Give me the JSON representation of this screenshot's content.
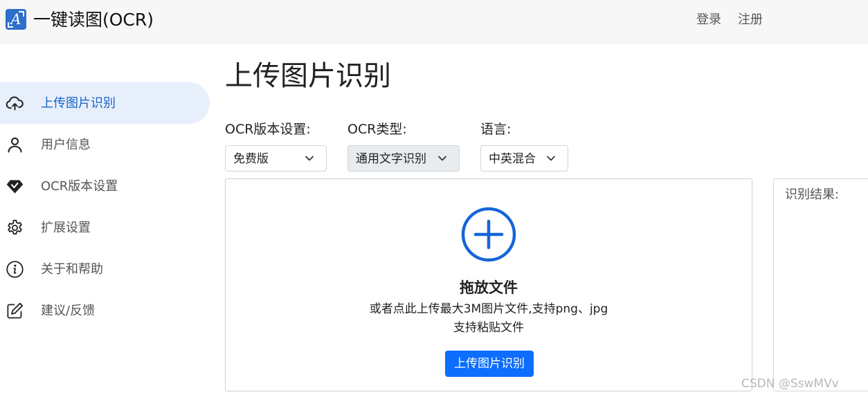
{
  "header": {
    "logo_glyph": "A",
    "app_title": "一键读图(OCR)",
    "login": "登录",
    "register": "注册"
  },
  "sidebar": {
    "items": [
      {
        "label": "上传图片识别",
        "icon": "cloud-upload-icon",
        "active": true
      },
      {
        "label": "用户信息",
        "icon": "user-icon",
        "active": false
      },
      {
        "label": "OCR版本设置",
        "icon": "gem-icon",
        "active": false
      },
      {
        "label": "扩展设置",
        "icon": "gear-icon",
        "active": false
      },
      {
        "label": "关于和帮助",
        "icon": "info-icon",
        "active": false
      },
      {
        "label": "建议/反馈",
        "icon": "edit-icon",
        "active": false
      }
    ]
  },
  "main": {
    "title": "上传图片识别",
    "version": {
      "label": "OCR版本设置:",
      "value": "免费版"
    },
    "type": {
      "label": "OCR类型:",
      "value": "通用文字识别"
    },
    "language": {
      "label": "语言:",
      "value": "中英混合"
    },
    "dropzone": {
      "title": "拖放文件",
      "hint1": "或者点此上传最大3M图片文件,支持png、jpg",
      "hint2": "支持粘贴文件",
      "button": "上传图片识别"
    },
    "result": {
      "label": "识别结果:"
    }
  },
  "watermark": "CSDN @SswMVv",
  "colors": {
    "accent": "#0d6efd",
    "active_bg": "#e7effb",
    "active_text": "#1a64c7",
    "header_bg": "#f7f7f7",
    "plus_icon": "#1565d8"
  }
}
